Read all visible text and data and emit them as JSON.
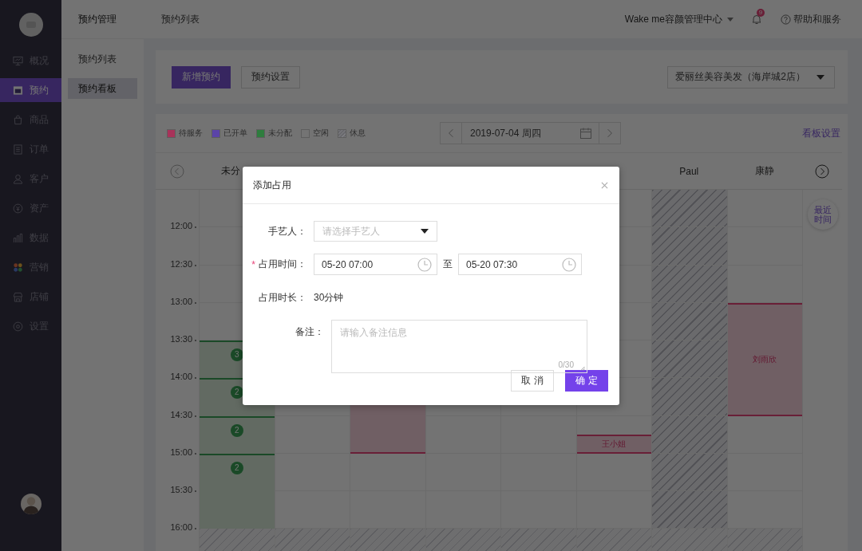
{
  "sidebar": {
    "items": [
      {
        "label": "概况",
        "selected": false
      },
      {
        "label": "预约",
        "selected": true
      },
      {
        "label": "商品",
        "selected": false
      },
      {
        "label": "订单",
        "selected": false
      },
      {
        "label": "客户",
        "selected": false
      },
      {
        "label": "资产",
        "selected": false
      },
      {
        "label": "数据",
        "selected": false
      },
      {
        "label": "营销",
        "selected": false
      },
      {
        "label": "店铺",
        "selected": false
      },
      {
        "label": "设置",
        "selected": false
      }
    ]
  },
  "header": {
    "section": "预约管理",
    "page": "预约列表",
    "org": "Wake me容颜管理中心",
    "notifications": "9",
    "help": "帮助和服务"
  },
  "subnav": [
    {
      "label": "预约列表",
      "selected": false
    },
    {
      "label": "预约看板",
      "selected": true
    }
  ],
  "toolbar": {
    "buttons": [
      {
        "label": "新增预约",
        "kind": "primary"
      },
      {
        "label": "预约设置",
        "kind": "default"
      }
    ],
    "store": "爱丽丝美容美发（海岸城2店）"
  },
  "board": {
    "legend": [
      {
        "label": "待服务",
        "color": "#a8335a",
        "kind": "solid"
      },
      {
        "label": "已开单",
        "color": "#5b44a8",
        "kind": "solid"
      },
      {
        "label": "未分配",
        "color": "#2e7d3e",
        "kind": "solid"
      },
      {
        "label": "空闲",
        "color": "#747474",
        "kind": "solid"
      },
      {
        "label": "休息",
        "color": "#6a6a6e",
        "kind": "hatched"
      }
    ],
    "date": "2019-07-04 周四",
    "settings": "看板设置",
    "recent": "最近时间",
    "columns": [
      {
        "name": "未分",
        "rest": false,
        "events": [
          {
            "kind": "unassigned",
            "count": "3"
          },
          {
            "kind": "unassigned",
            "count": "2"
          },
          {
            "kind": "unassigned",
            "count": "2"
          },
          {
            "kind": "unassigned",
            "count": "2"
          }
        ]
      },
      {
        "rest": false
      },
      {
        "rest": false,
        "events": [
          {
            "kind": "pending"
          }
        ]
      },
      {
        "rest": false
      },
      {
        "rest": false
      },
      {
        "rest": false,
        "events": [
          {
            "kind": "pending",
            "label": "王小姐"
          }
        ]
      },
      {
        "name": "Paul",
        "rest": true
      },
      {
        "name": "康静",
        "rest": false,
        "events": [
          {
            "kind": "pending",
            "label": "刘雨欣"
          }
        ]
      }
    ],
    "times": [
      "12:00",
      "12:30",
      "13:00",
      "13:30",
      "14:00",
      "14:30",
      "15:00",
      "15:30",
      "16:00"
    ]
  },
  "dialog": {
    "title": "添加占用",
    "artisan": {
      "label": "手艺人：",
      "placeholder": "请选择手艺人"
    },
    "time": {
      "label": "占用时间：",
      "required_mark": "*",
      "start": "05-20 07:00",
      "separator": "至",
      "end": "05-20 07:30"
    },
    "duration": {
      "label": "占用时长：",
      "value": "30分钟"
    },
    "note": {
      "label": "备注：",
      "placeholder": "请输入备注信息",
      "counter": "0/30"
    },
    "cancel": "取 消",
    "confirm": "确 定"
  }
}
